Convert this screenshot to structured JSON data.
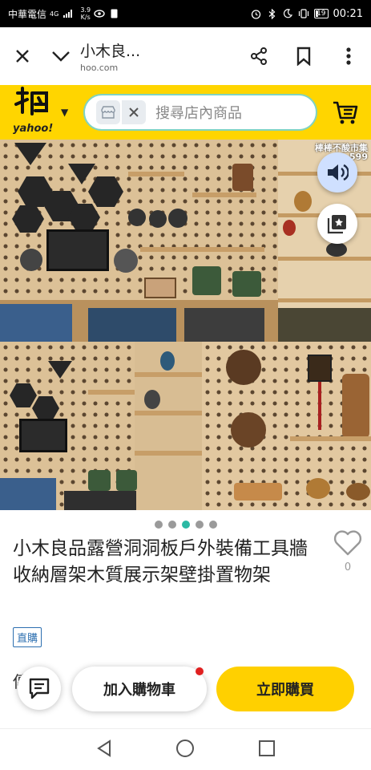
{
  "status_bar": {
    "carrier": "中華電信",
    "network": "4G",
    "speed_value": "3.9",
    "speed_unit": "K/s",
    "battery": "19",
    "time": "00:21"
  },
  "browser": {
    "title": "小木良...",
    "url": "hoo.com"
  },
  "store": {
    "logo_text": "yahoo!",
    "search_placeholder": "搜尋店內商品"
  },
  "gallery": {
    "watermark_line1": "棒棒不酸市集",
    "watermark_line2": "599",
    "dot_count": 5,
    "active_dot": 3
  },
  "product": {
    "title": "小木良品露營洞洞板戶外裝備工具牆收納層架木質展示架壁掛置物架",
    "favorite_count": "0",
    "badge": "直購",
    "price_peek": "傳"
  },
  "actions": {
    "add_to_cart": "加入購物車",
    "buy_now": "立即購買"
  },
  "colors": {
    "brand_yellow": "#ffd500",
    "accent_teal": "#2bb9a4",
    "badge_blue": "#2d6fb0"
  }
}
